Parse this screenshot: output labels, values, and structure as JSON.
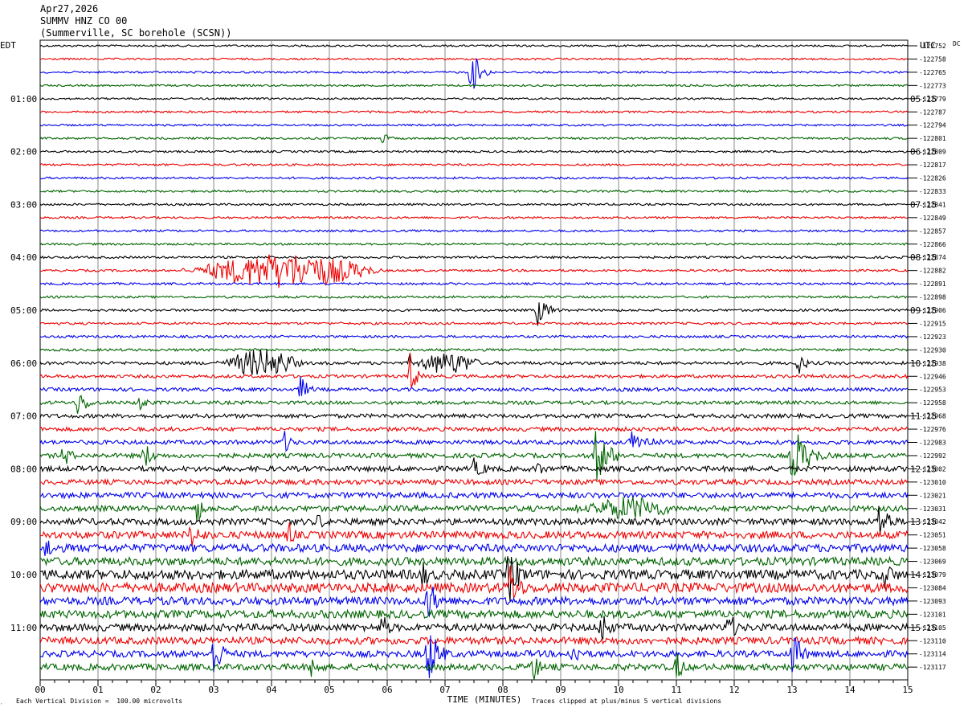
{
  "header": {
    "date": "Apr27,2026",
    "station": "SUMMV HNZ CO 00",
    "location": "(Summerville, SC borehole (SCSN))"
  },
  "chart_data": {
    "type": "line",
    "title": "SUMMV HNZ CO 00",
    "left_axis_label": "EDT",
    "right_axis_label": "UTC",
    "dc_label": "DC",
    "xlabel": "TIME (MINUTES)",
    "xlim": [
      0,
      15
    ],
    "x_ticks": [
      "00",
      "01",
      "02",
      "03",
      "04",
      "05",
      "06",
      "07",
      "08",
      "09",
      "10",
      "11",
      "12",
      "13",
      "14",
      "15"
    ],
    "trace_minutes": 15,
    "trace_count": 48,
    "trace_colors": [
      "#000000",
      "#ee0000",
      "#0000ee",
      "#006400"
    ],
    "left_hour_labels": [
      "01:00",
      "02:00",
      "03:00",
      "04:00",
      "05:00",
      "06:00",
      "07:00",
      "08:00",
      "09:00",
      "10:00",
      "11:00"
    ],
    "right_hour_labels": [
      "05:15",
      "06:15",
      "07:15",
      "08:15",
      "09:15",
      "10:15",
      "11:15",
      "12:15",
      "13:15",
      "14:15",
      "15:15"
    ],
    "hour_label_rows": [
      4,
      8,
      12,
      16,
      20,
      24,
      28,
      32,
      36,
      40,
      44
    ],
    "dc_offsets": [
      "-122752",
      "-122758",
      "-122765",
      "-122773",
      "-122779",
      "-122787",
      "-122794",
      "-122801",
      "-122809",
      "-122817",
      "-122826",
      "-122833",
      "-122841",
      "-122849",
      "-122857",
      "-122866",
      "-122874",
      "-122882",
      "-122891",
      "-122898",
      "-122906",
      "-122915",
      "-122923",
      "-122930",
      "-122938",
      "-122946",
      "-122953",
      "-122958",
      "-122968",
      "-122976",
      "-122983",
      "-122992",
      "-123002",
      "-123010",
      "-123021",
      "-123031",
      "-123042",
      "-123051",
      "-123058",
      "-123069",
      "-123079",
      "-123084",
      "-123093",
      "-123101",
      "-123105",
      "-123110",
      "-123114",
      "-123117"
    ],
    "noise_amplitude_by_trace": [
      1.2,
      1.2,
      1.2,
      1.2,
      1.2,
      1.3,
      1.2,
      1.3,
      1.3,
      1.3,
      1.3,
      1.3,
      1.3,
      1.3,
      1.3,
      1.3,
      1.4,
      1.4,
      1.4,
      1.4,
      1.5,
      1.5,
      1.5,
      1.6,
      2.0,
      2.0,
      2.2,
      2.2,
      2.5,
      2.5,
      2.6,
      2.8,
      3.2,
      3.2,
      3.5,
      3.5,
      4.0,
      4.5,
      5.0,
      5.0,
      6.0,
      6.0,
      5.0,
      5.0,
      4.5,
      4.5,
      4.0,
      4.0
    ],
    "events": [
      {
        "trace": 2,
        "minute": 7.45,
        "amplitude": 35,
        "duration": 0.3
      },
      {
        "trace": 7,
        "minute": 5.9,
        "amplitude": 8,
        "duration": 0.3
      },
      {
        "trace": 17,
        "minute": 2.5,
        "amplitude": 22,
        "duration": 3.5
      },
      {
        "trace": 20,
        "minute": 8.6,
        "amplitude": 20,
        "duration": 0.4
      },
      {
        "trace": 24,
        "minute": 3.1,
        "amplitude": 18,
        "duration": 1.5
      },
      {
        "trace": 24,
        "minute": 6.4,
        "amplitude": 14,
        "duration": 1.3
      },
      {
        "trace": 24,
        "minute": 13.1,
        "amplitude": 16,
        "duration": 0.3
      },
      {
        "trace": 25,
        "minute": 6.4,
        "amplitude": 35,
        "duration": 0.2
      },
      {
        "trace": 26,
        "minute": 4.5,
        "amplitude": 18,
        "duration": 0.3
      },
      {
        "trace": 27,
        "minute": 0.65,
        "amplitude": 18,
        "duration": 0.4
      },
      {
        "trace": 27,
        "minute": 1.7,
        "amplitude": 14,
        "duration": 0.3
      },
      {
        "trace": 30,
        "minute": 4.2,
        "amplitude": 18,
        "duration": 0.3
      },
      {
        "trace": 30,
        "minute": 10.2,
        "amplitude": 16,
        "duration": 0.8
      },
      {
        "trace": 31,
        "minute": 9.6,
        "amplitude": 38,
        "duration": 0.5
      },
      {
        "trace": 31,
        "minute": 13.0,
        "amplitude": 40,
        "duration": 0.6
      },
      {
        "trace": 31,
        "minute": 1.8,
        "amplitude": 20,
        "duration": 0.3
      },
      {
        "trace": 31,
        "minute": 0.4,
        "amplitude": 18,
        "duration": 0.3
      },
      {
        "trace": 32,
        "minute": 7.5,
        "amplitude": 14,
        "duration": 0.5
      },
      {
        "trace": 32,
        "minute": 8.6,
        "amplitude": 12,
        "duration": 0.3
      },
      {
        "trace": 35,
        "minute": 2.7,
        "amplitude": 20,
        "duration": 0.3
      },
      {
        "trace": 35,
        "minute": 9.3,
        "amplitude": 15,
        "duration": 1.8
      },
      {
        "trace": 36,
        "minute": 4.8,
        "amplitude": 12,
        "duration": 0.4
      },
      {
        "trace": 36,
        "minute": 14.5,
        "amplitude": 30,
        "duration": 0.4
      },
      {
        "trace": 37,
        "minute": 2.6,
        "amplitude": 18,
        "duration": 0.5
      },
      {
        "trace": 37,
        "minute": 4.3,
        "amplitude": 22,
        "duration": 0.2
      },
      {
        "trace": 38,
        "minute": 0.1,
        "amplitude": 18,
        "duration": 0.3
      },
      {
        "trace": 40,
        "minute": 8.1,
        "amplitude": 40,
        "duration": 0.4
      },
      {
        "trace": 40,
        "minute": 6.6,
        "amplitude": 22,
        "duration": 0.3
      },
      {
        "trace": 40,
        "minute": 14.6,
        "amplitude": 20,
        "duration": 0.4
      },
      {
        "trace": 41,
        "minute": 8.1,
        "amplitude": 35,
        "duration": 0.4
      },
      {
        "trace": 42,
        "minute": 6.7,
        "amplitude": 30,
        "duration": 0.4
      },
      {
        "trace": 44,
        "minute": 5.9,
        "amplitude": 22,
        "duration": 0.3
      },
      {
        "trace": 44,
        "minute": 9.7,
        "amplitude": 28,
        "duration": 0.3
      },
      {
        "trace": 44,
        "minute": 11.9,
        "amplitude": 24,
        "duration": 0.3
      },
      {
        "trace": 46,
        "minute": 3.0,
        "amplitude": 36,
        "duration": 0.3
      },
      {
        "trace": 46,
        "minute": 6.7,
        "amplitude": 42,
        "duration": 0.4
      },
      {
        "trace": 46,
        "minute": 9.2,
        "amplitude": 20,
        "duration": 0.3
      },
      {
        "trace": 46,
        "minute": 13.0,
        "amplitude": 30,
        "duration": 0.4
      },
      {
        "trace": 47,
        "minute": 4.7,
        "amplitude": 20,
        "duration": 0.3
      },
      {
        "trace": 47,
        "minute": 8.5,
        "amplitude": 24,
        "duration": 0.3
      },
      {
        "trace": 47,
        "minute": 11.0,
        "amplitude": 22,
        "duration": 0.3
      }
    ],
    "scale_note": "Each Vertical Division =  100.00 microvolts",
    "clip_note": "Traces clipped at plus/minus 5 vertical divisions"
  }
}
